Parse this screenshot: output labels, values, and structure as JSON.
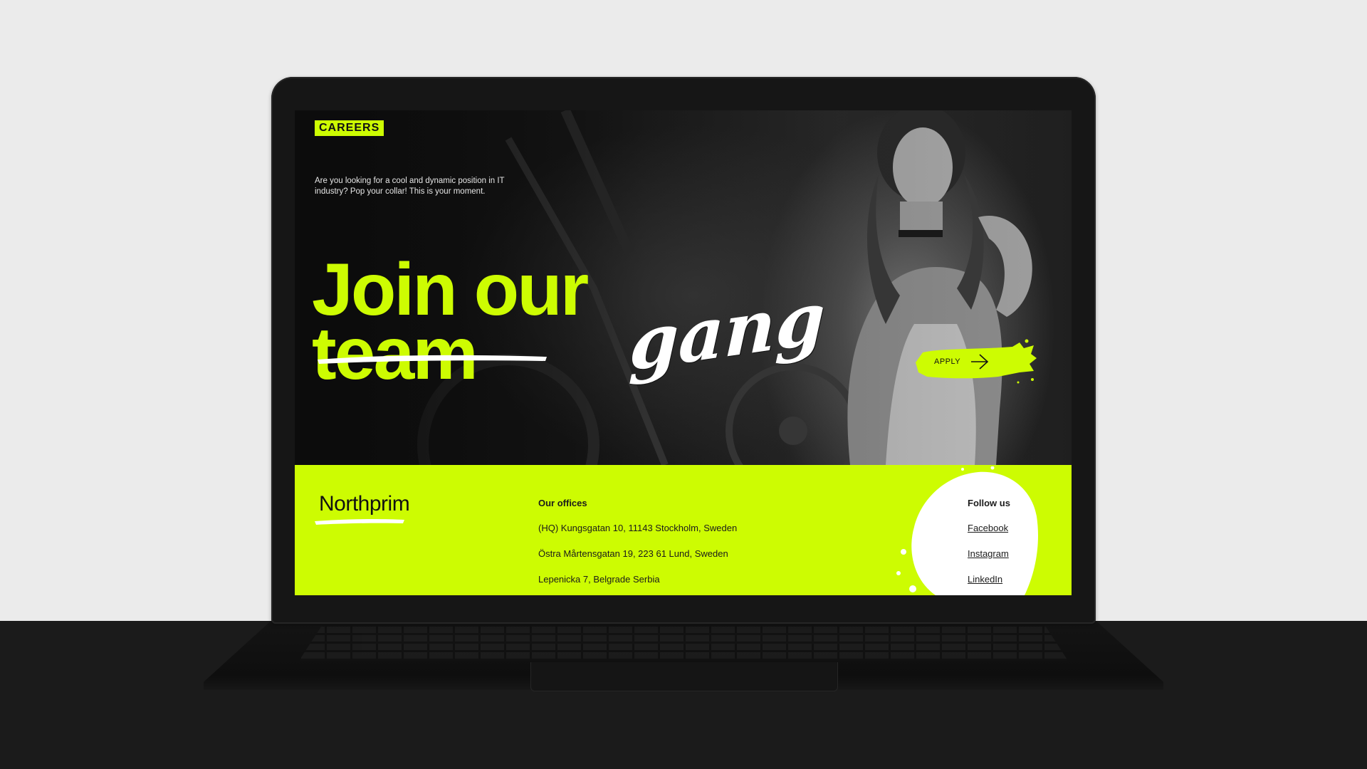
{
  "colors": {
    "accent": "#cdfc02",
    "dark": "#111111",
    "white": "#ffffff"
  },
  "hero": {
    "tag": "CAREERS",
    "intro": "Are you looking for a cool and dynamic position in IT industry? Pop your collar! This is your moment.",
    "headline_line1": "Join our",
    "headline_struck": "team",
    "headline_script": "gang",
    "apply_label": "APPLY"
  },
  "footer": {
    "brand": "Northprim",
    "offices_title": "Our offices",
    "offices": [
      "(HQ) Kungsgatan 10, 11143 Stockholm, Sweden",
      "Östra Mårtensgatan 19, 223 61 Lund, Sweden",
      "Lepenicka 7, Belgrade Serbia"
    ],
    "follow_title": "Follow us",
    "social": [
      "Facebook",
      "Instagram",
      "LinkedIn"
    ]
  },
  "icons": {
    "apply_arrow": "arrow-right-icon"
  }
}
